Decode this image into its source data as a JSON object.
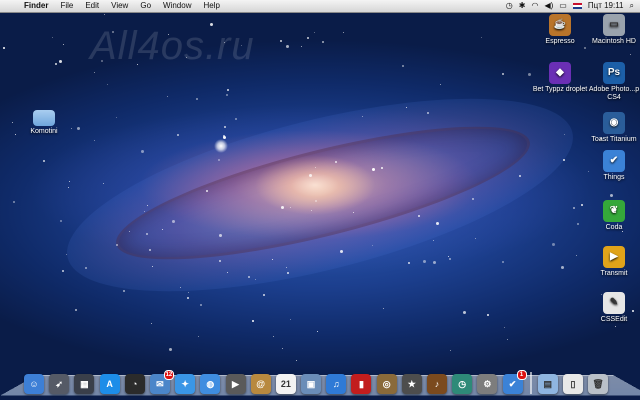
{
  "menubar": {
    "app_name": "Finder",
    "items": [
      "File",
      "Edit",
      "View",
      "Go",
      "Window",
      "Help"
    ],
    "clock": "Пцт 19:11"
  },
  "watermark": "All4os.ru",
  "desktop_left": {
    "label": "Komotini"
  },
  "desktop_right": [
    {
      "label": "Espresso",
      "icon": "espresso-icon",
      "color": "#b9742a",
      "glyph": "☕"
    },
    {
      "label": "Macintosh HD",
      "icon": "hard-drive-icon",
      "color": "#9aa3ad",
      "glyph": "▭"
    },
    {
      "label": "Bet Typpz droplet",
      "icon": "droplet-icon",
      "color": "#6a2fb5",
      "glyph": "◆"
    },
    {
      "label": "Adobe Photo...p CS4",
      "icon": "photoshop-icon",
      "color": "#1c5fa8",
      "glyph": "Ps"
    },
    {
      "label": "Toast Titanium",
      "icon": "toast-icon",
      "color": "#2a5d9a",
      "glyph": "◉"
    },
    {
      "label": "Things",
      "icon": "things-icon",
      "color": "#3b82d6",
      "glyph": "✔"
    },
    {
      "label": "Coda",
      "icon": "coda-leaf-icon",
      "color": "#35a83a",
      "glyph": "❦"
    },
    {
      "label": "Transmit",
      "icon": "transmit-truck-icon",
      "color": "#e0a31a",
      "glyph": "▶"
    },
    {
      "label": "CSSEdit",
      "icon": "cssedit-icon",
      "color": "#e6e6e6",
      "glyph": "✎"
    }
  ],
  "dock": {
    "apps": [
      {
        "icon": "finder-icon",
        "color": "#3d7fd6",
        "glyph": "☺"
      },
      {
        "icon": "launchpad-rocket-icon",
        "color": "#555a66",
        "glyph": "➶"
      },
      {
        "icon": "mission-control-icon",
        "color": "#3a3f4a",
        "glyph": "▦"
      },
      {
        "icon": "app-store-icon",
        "color": "#1d8de8",
        "glyph": "A"
      },
      {
        "icon": "dashboard-icon",
        "color": "#2b2b2b",
        "glyph": "◔"
      },
      {
        "icon": "mail-icon",
        "color": "#4b86c9",
        "glyph": "✉",
        "badge": "12"
      },
      {
        "icon": "safari-compass-icon",
        "color": "#3a96e6",
        "glyph": "✦"
      },
      {
        "icon": "ichat-icon",
        "color": "#3f8de0",
        "glyph": "◍"
      },
      {
        "icon": "facetime-icon",
        "color": "#5a5a5a",
        "glyph": "▶"
      },
      {
        "icon": "address-book-icon",
        "color": "#b8893f",
        "glyph": "@"
      },
      {
        "icon": "calendar-icon",
        "color": "#f2f2f2",
        "glyph": "21"
      },
      {
        "icon": "preview-icon",
        "color": "#6a8db8",
        "glyph": "▣"
      },
      {
        "icon": "itunes-icon",
        "color": "#2f7ad6",
        "glyph": "♫"
      },
      {
        "icon": "photo-booth-icon",
        "color": "#c21d1d",
        "glyph": "▮"
      },
      {
        "icon": "iphoto-icon",
        "color": "#8a6a3a",
        "glyph": "◎"
      },
      {
        "icon": "imovie-star-icon",
        "color": "#4d4d4d",
        "glyph": "★"
      },
      {
        "icon": "garageband-guitar-icon",
        "color": "#7b4a1e",
        "glyph": "♪"
      },
      {
        "icon": "time-machine-icon",
        "color": "#2e8a78",
        "glyph": "◷"
      },
      {
        "icon": "system-preferences-icon",
        "color": "#7d7d7d",
        "glyph": "⚙"
      },
      {
        "icon": "things-dock-icon",
        "color": "#3b82d6",
        "glyph": "✔",
        "badge": "1"
      }
    ],
    "folders": [
      {
        "icon": "applications-folder-icon",
        "color": "#8fb5e0",
        "glyph": "▤"
      },
      {
        "icon": "documents-stack-icon",
        "color": "#e8e8e8",
        "glyph": "▯"
      },
      {
        "icon": "trash-icon",
        "color": "#b9c0c8",
        "glyph": "🗑"
      }
    ]
  }
}
